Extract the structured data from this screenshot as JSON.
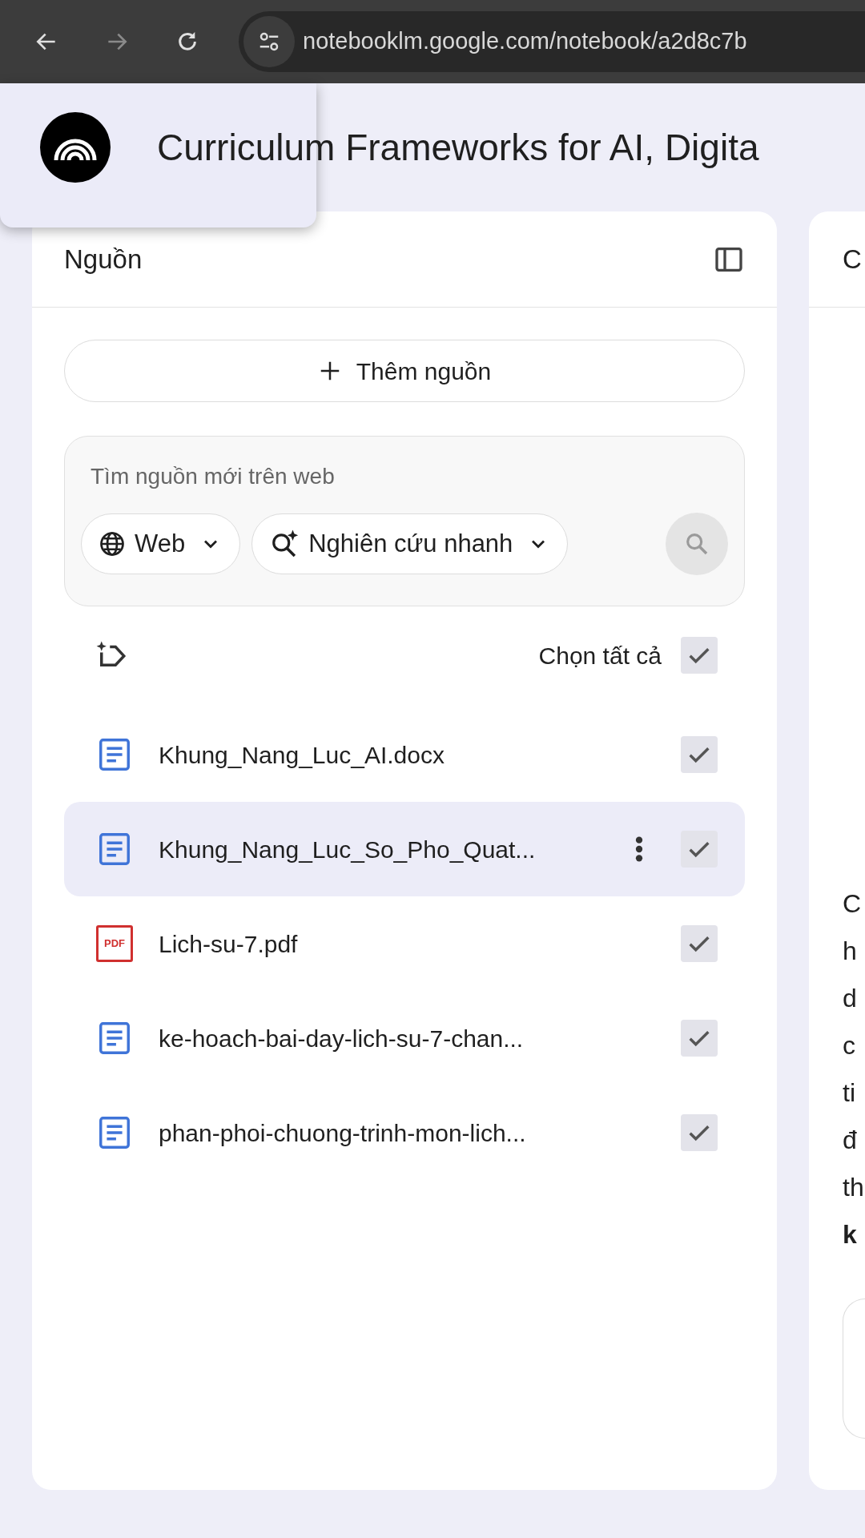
{
  "browser": {
    "url": "notebooklm.google.com/notebook/a2d8c7b"
  },
  "notebook": {
    "title": "Curriculum Frameworks for AI, Digita"
  },
  "sources_panel": {
    "title": "Nguồn",
    "add_button": "Thêm nguồn",
    "search": {
      "placeholder": "Tìm nguồn mới trên web",
      "chips": [
        "Web",
        "Nghiên cứu nhanh"
      ]
    },
    "select_all": {
      "label": "Chọn tất cả",
      "checked": true
    },
    "items": [
      {
        "kind": "doc",
        "name": "Khung_Nang_Luc_AI.docx",
        "checked": true,
        "selected": false
      },
      {
        "kind": "doc",
        "name": "Khung_Nang_Luc_So_Pho_Quat...",
        "checked": true,
        "selected": true
      },
      {
        "kind": "pdf",
        "icon_text": "PDF",
        "name": "Lich-su-7.pdf",
        "checked": true,
        "selected": false
      },
      {
        "kind": "doc",
        "name": "ke-hoach-bai-day-lich-su-7-chan...",
        "checked": true,
        "selected": false
      },
      {
        "kind": "doc",
        "name": "phan-phoi-chuong-trinh-mon-lich...",
        "checked": true,
        "selected": false
      }
    ]
  },
  "chat_panel": {
    "title": "C",
    "lines": [
      {
        "text": "C",
        "bold": false
      },
      {
        "text": "h",
        "bold": false
      },
      {
        "text": "d",
        "bold": false
      },
      {
        "text": "c",
        "bold": false
      },
      {
        "text": "ti",
        "bold": false
      },
      {
        "text": "đ",
        "bold": false
      },
      {
        "text": "th",
        "bold": false
      },
      {
        "text": "k",
        "bold": true
      }
    ]
  }
}
